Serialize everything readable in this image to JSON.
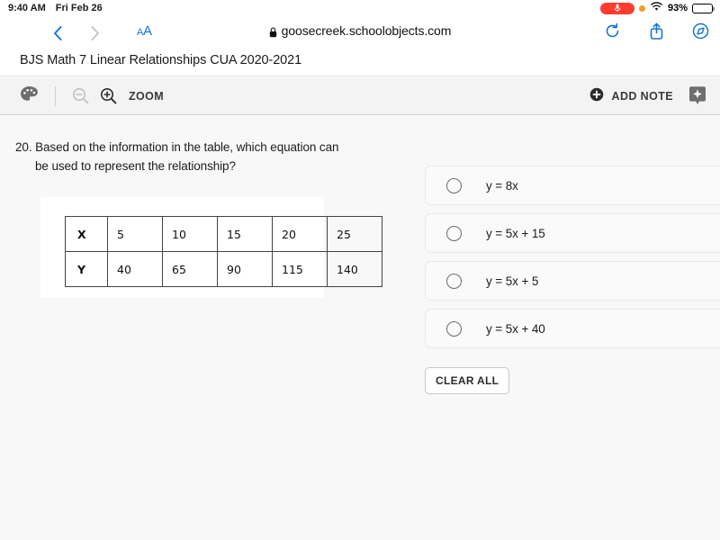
{
  "statusbar": {
    "time": "9:40 AM",
    "date": "Fri Feb 26",
    "mic_icon": "microphone-icon",
    "orange_dot": "mic-in-use-indicator",
    "wifi_icon": "wifi-icon",
    "battery_percent": "93%",
    "battery_icon": "battery-icon"
  },
  "browser": {
    "back_icon": "chevron-left-icon",
    "forward_icon": "chevron-right-icon",
    "text_size_label": "AA",
    "lock_icon": "lock-icon",
    "url": "goosecreek.schoolobjects.com",
    "reload_icon": "reload-icon",
    "share_icon": "share-icon",
    "compass_icon": "compass-icon"
  },
  "app": {
    "title": "BJS Math 7 Linear Relationships CUA 2020-2021"
  },
  "toolbar": {
    "palette_icon": "palette-icon",
    "zoom_out_icon": "zoom-out-icon",
    "zoom_in_icon": "zoom-in-icon",
    "zoom_label": "ZOOM",
    "add_note_icon": "plus-circle-icon",
    "add_note_label": "ADD NOTE",
    "bookmark_icon": "bookmark-star-icon"
  },
  "question": {
    "number": "20.",
    "line1": "Based on the information in the table, which equation can",
    "line2": "be used to represent the relationship?"
  },
  "chart_data": {
    "type": "table",
    "title": "",
    "rows": [
      {
        "label": "X",
        "values": [
          "5",
          "10",
          "15",
          "20",
          "25"
        ]
      },
      {
        "label": "Y",
        "values": [
          "40",
          "65",
          "90",
          "115",
          "140"
        ]
      }
    ]
  },
  "answers": {
    "options": [
      {
        "text": "y = 8x",
        "selected": false
      },
      {
        "text": "y = 5x + 15",
        "selected": false
      },
      {
        "text": "y = 5x + 5",
        "selected": false
      },
      {
        "text": "y = 5x + 40",
        "selected": false
      }
    ],
    "clear_all_label": "CLEAR ALL"
  },
  "colors": {
    "accent_blue": "#1474d4",
    "record_red": "#ff3b30",
    "page_bg": "#f8f8f8",
    "toolbar_bg": "#f3f3f3"
  }
}
